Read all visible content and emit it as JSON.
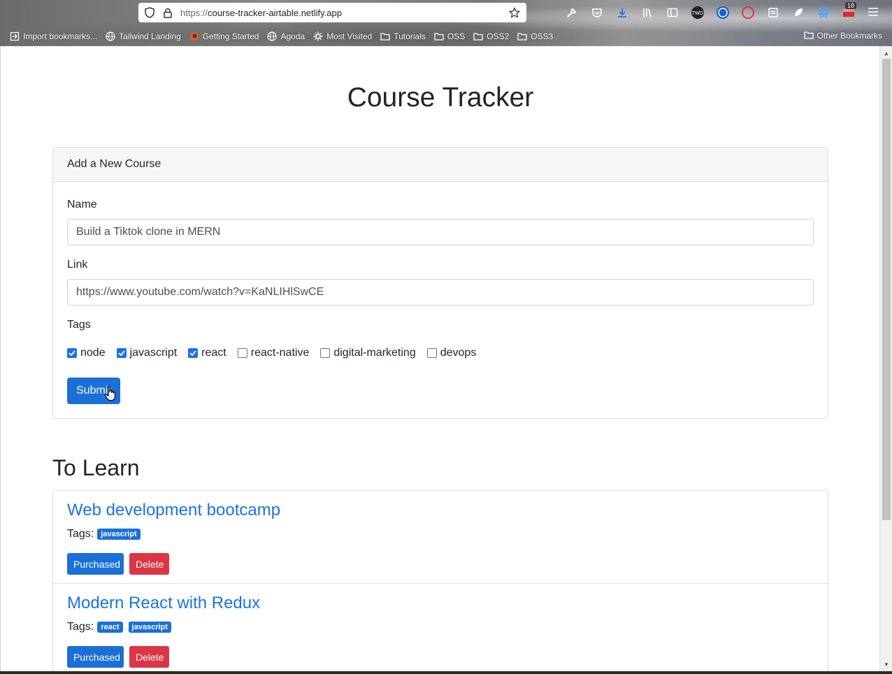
{
  "browser": {
    "url_protocol": "https://",
    "url_host": "course-tracker-airtable.netlify.app",
    "extension_badge": "18",
    "bookmarks": [
      {
        "label": "Import bookmarks...",
        "icon": "import-icon"
      },
      {
        "label": "Tailwind Landing",
        "icon": "globe-icon"
      },
      {
        "label": "Getting Started",
        "icon": "firefox-icon"
      },
      {
        "label": "Agoda",
        "icon": "globe-icon"
      },
      {
        "label": "Most Visited",
        "icon": "gear-icon"
      },
      {
        "label": "Tutorials",
        "icon": "folder-icon"
      },
      {
        "label": "OSS",
        "icon": "folder-icon"
      },
      {
        "label": "OSS2",
        "icon": "folder-icon"
      },
      {
        "label": "OSS3",
        "icon": "folder-icon"
      }
    ],
    "other_bookmarks": "Other Bookmarks"
  },
  "page": {
    "title": "Course Tracker"
  },
  "form": {
    "header": "Add a New Course",
    "name_label": "Name",
    "name_value": "Build a Tiktok clone in MERN",
    "link_label": "Link",
    "link_value": "https://www.youtube.com/watch?v=KaNLIHlSwCE",
    "tags_label": "Tags",
    "tags": [
      {
        "label": "node",
        "checked": true
      },
      {
        "label": "javascript",
        "checked": true
      },
      {
        "label": "react",
        "checked": true
      },
      {
        "label": "react-native",
        "checked": false
      },
      {
        "label": "digital-marketing",
        "checked": false
      },
      {
        "label": "devops",
        "checked": false
      }
    ],
    "submit_label": "Submit"
  },
  "to_learn": {
    "title": "To Learn",
    "courses": [
      {
        "name": "Web development bootcamp",
        "tags_label": "Tags:",
        "tags": [
          "javascript"
        ],
        "purchased_label": "Purchased",
        "delete_label": "Delete"
      },
      {
        "name": "Modern React with Redux",
        "tags_label": "Tags:",
        "tags": [
          "react",
          "javascript"
        ],
        "purchased_label": "Purchased",
        "delete_label": "Delete"
      }
    ]
  },
  "colors": {
    "primary": "#1b6fd8",
    "link": "#1a73e8",
    "danger": "#dc3545",
    "card_header_bg": "#f7f7f7"
  }
}
